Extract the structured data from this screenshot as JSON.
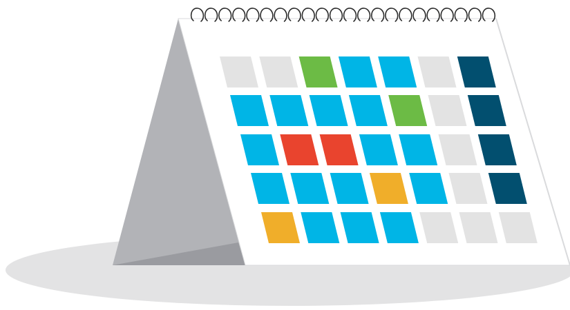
{
  "illustration": {
    "subject": "desk-calendar",
    "colors": {
      "background": "#ffffff",
      "shadow": "#e3e3e4",
      "stand_light": "#b2b3b7",
      "stand_dark": "#9a9ba0",
      "page": "#ffffff",
      "page_edge": "#d9dadc",
      "spiral": "#2a2a2a",
      "empty": "#e3e3e3",
      "blue": "#00b5e6",
      "green": "#6cbb45",
      "red": "#e9442e",
      "orange": "#f0ae2a",
      "navy": "#024f6f"
    },
    "spiral_loop_count": 22,
    "columns": 7,
    "grid": [
      [
        "empty",
        "empty",
        "green",
        "blue",
        "blue",
        "empty",
        "navy"
      ],
      [
        "blue",
        "blue",
        "blue",
        "blue",
        "green",
        "empty",
        "navy"
      ],
      [
        "blue",
        "red",
        "red",
        "blue",
        "blue",
        "empty",
        "navy"
      ],
      [
        "blue",
        "blue",
        "blue",
        "orange",
        "blue",
        "empty",
        "navy"
      ],
      [
        "orange",
        "blue",
        "blue",
        "blue",
        "empty",
        "empty",
        "empty"
      ]
    ]
  }
}
